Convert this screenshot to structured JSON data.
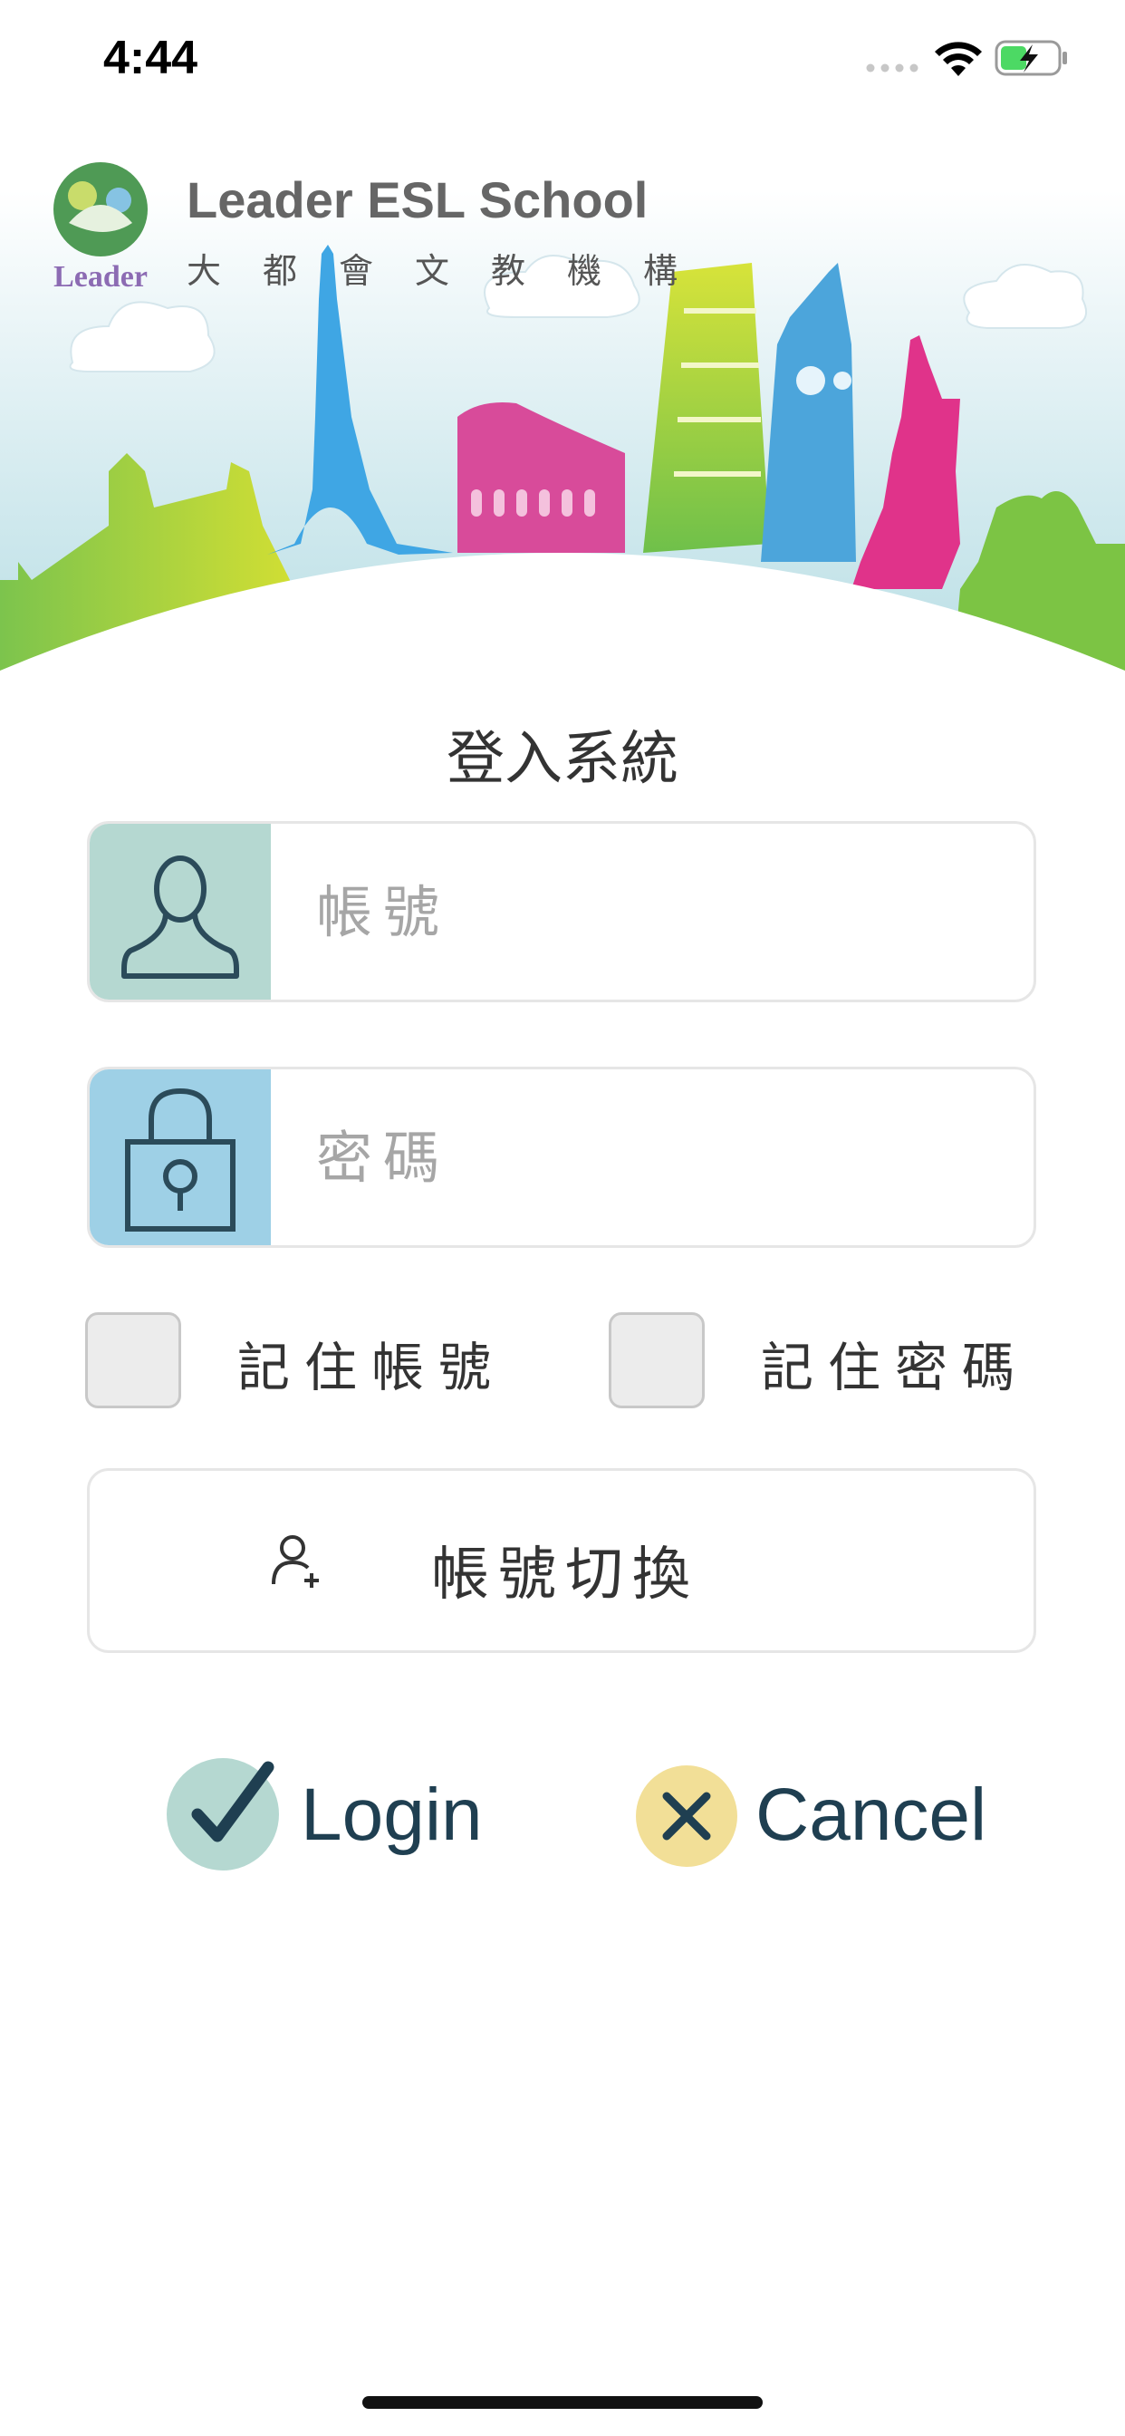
{
  "status_bar": {
    "time": "4:44",
    "icons": [
      "signal-dots-icon",
      "wifi-icon",
      "battery-charging-icon"
    ]
  },
  "brand": {
    "logo_text": "Leader",
    "title": "Leader ESL School",
    "subtitle": "大都會文教機構"
  },
  "login": {
    "heading": "登入系統",
    "username_placeholder": "帳號",
    "password_placeholder": "密碼",
    "remember_account_label": "記住帳號",
    "remember_password_label": "記住密碼",
    "switch_account_label": "帳號切換",
    "login_label": "Login",
    "cancel_label": "Cancel"
  },
  "colors": {
    "username_icon_bg": "#b5d8d1",
    "password_icon_bg": "#9ed0e6",
    "login_circle": "#b5d8d1",
    "cancel_circle": "#f2df97",
    "action_text": "#1f3f51"
  }
}
